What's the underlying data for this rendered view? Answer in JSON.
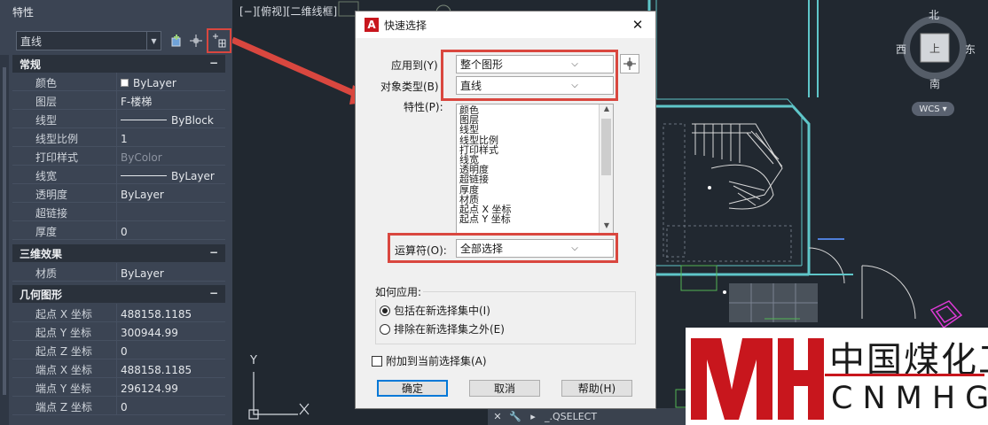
{
  "properties": {
    "title": "特性",
    "object_select": "直线",
    "sections": [
      {
        "name": "常规",
        "toggle": "−",
        "rows": [
          {
            "key": "颜色",
            "value": "ByLayer"
          },
          {
            "key": "图层",
            "value": "F-楼梯"
          },
          {
            "key": "线型",
            "value": "ByBlock"
          },
          {
            "key": "线型比例",
            "value": "1"
          },
          {
            "key": "打印样式",
            "value": "ByColor"
          },
          {
            "key": "线宽",
            "value": "ByLayer"
          },
          {
            "key": "透明度",
            "value": "ByLayer"
          },
          {
            "key": "超链接",
            "value": ""
          },
          {
            "key": "厚度",
            "value": "0"
          }
        ]
      },
      {
        "name": "三维效果",
        "toggle": "−",
        "rows": [
          {
            "key": "材质",
            "value": "ByLayer"
          }
        ]
      },
      {
        "name": "几何图形",
        "toggle": "−",
        "rows": [
          {
            "key": "起点 X 坐标",
            "value": "488158.1185"
          },
          {
            "key": "起点 Y 坐标",
            "value": "300944.99"
          },
          {
            "key": "起点 Z 坐标",
            "value": "0"
          },
          {
            "key": "端点 X 坐标",
            "value": "488158.1185"
          },
          {
            "key": "端点 Y 坐标",
            "value": "296124.99"
          },
          {
            "key": "端点 Z 坐标",
            "value": "0"
          }
        ]
      }
    ]
  },
  "viewport": {
    "label": "[−][俯视][二维线框]",
    "compass": {
      "n": "北",
      "s": "南",
      "e": "东",
      "w": "西",
      "center": "上"
    },
    "wcs": "WCS",
    "axis_x": "X",
    "axis_y": "Y"
  },
  "dialog": {
    "title": "快速选择",
    "close": "✕",
    "apply_to_label": "应用到(Y)",
    "apply_to_value": "整个图形",
    "object_type_label": "对象类型(B)",
    "object_type_value": "直线",
    "properties_label": "特性(P):",
    "properties_list": [
      "颜色",
      "图层",
      "线型",
      "线型比例",
      "打印样式",
      "线宽",
      "透明度",
      "超链接",
      "厚度",
      "材质",
      "起点 X 坐标",
      "起点 Y 坐标"
    ],
    "operator_label": "运算符(O):",
    "operator_value": "全部选择",
    "how_to_apply_label": "如何应用:",
    "radio_include": "包括在新选择集中(I)",
    "radio_exclude": "排除在新选择集之外(E)",
    "append_label": "附加到当前选择集(A)",
    "ok": "确定",
    "cancel": "取消",
    "help": "帮助(H)"
  },
  "command_line": {
    "text": "_.QSELECT"
  },
  "watermark": {
    "cn": "中国煤化工",
    "en": "CNMHG"
  },
  "colors": {
    "highlight": "#d9473f",
    "arrow": "#d9473f",
    "cyan_wall": "#5fc6c9",
    "magenta": "#e03ad8",
    "brand_red": "#c8161d"
  }
}
